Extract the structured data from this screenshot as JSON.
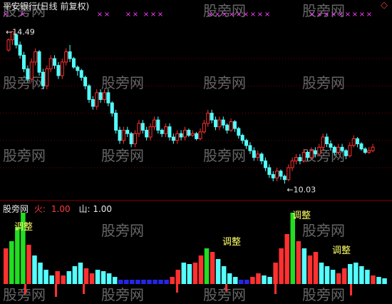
{
  "header": {
    "title": "平安银行(日线 前复权)",
    "diamond": "◇"
  },
  "indicator_header": {
    "name": "股旁网",
    "fire_label": "火:",
    "fire_value": "1.00",
    "mount_label": "山:",
    "mount_value": "1.00"
  },
  "colors": {
    "background": "#000000",
    "up": "#ff3030",
    "down": "#54ffff",
    "grid": "#7a0000",
    "marker": "#ff40ff",
    "green": "#22dd22",
    "blue": "#2a2aff",
    "annotation": "#ffff66",
    "watermark": "#666666"
  },
  "watermark": "股旁网",
  "chart_data": [
    {
      "type": "candlestick",
      "title": "平安银行(日线 前复权)",
      "ylim": [
        9.6,
        15.0
      ],
      "gridlines": [
        13.7,
        12.9,
        12.1,
        11.3,
        10.5
      ],
      "high_label": "14.49",
      "low_label": "10.03",
      "candles": [
        [
          13.95,
          14.25,
          14.3,
          13.9
        ],
        [
          14.25,
          14.49,
          14.49,
          14.1
        ],
        [
          14.4,
          14.1,
          14.45,
          14.0
        ],
        [
          14.1,
          13.8,
          14.2,
          13.7
        ],
        [
          13.8,
          13.4,
          13.9,
          13.3
        ],
        [
          13.4,
          13.1,
          13.5,
          13.0
        ],
        [
          13.1,
          13.6,
          13.7,
          13.0
        ],
        [
          13.6,
          13.9,
          14.0,
          13.5
        ],
        [
          13.9,
          13.3,
          13.95,
          13.2
        ],
        [
          13.3,
          12.9,
          13.4,
          12.8
        ],
        [
          12.9,
          13.4,
          13.5,
          12.8
        ],
        [
          13.4,
          13.7,
          13.8,
          13.3
        ],
        [
          13.7,
          13.5,
          13.8,
          13.4
        ],
        [
          13.5,
          13.2,
          13.6,
          13.1
        ],
        [
          13.2,
          13.6,
          13.7,
          13.1
        ],
        [
          13.6,
          13.9,
          14.0,
          13.5
        ],
        [
          13.9,
          13.7,
          14.1,
          13.6
        ],
        [
          13.7,
          13.45,
          13.75,
          13.4
        ],
        [
          13.45,
          13.35,
          13.5,
          13.2
        ],
        [
          13.35,
          13.15,
          13.4,
          13.05
        ],
        [
          13.15,
          12.9,
          13.2,
          12.8
        ],
        [
          12.9,
          12.5,
          12.95,
          12.4
        ],
        [
          12.5,
          12.3,
          12.6,
          12.2
        ],
        [
          12.3,
          12.7,
          12.8,
          12.2
        ],
        [
          12.7,
          12.5,
          12.8,
          12.4
        ],
        [
          12.5,
          12.7,
          12.8,
          12.4
        ],
        [
          12.7,
          12.4,
          12.8,
          12.3
        ],
        [
          12.4,
          12.1,
          12.45,
          12.0
        ],
        [
          12.1,
          11.6,
          12.2,
          11.5
        ],
        [
          11.6,
          11.3,
          11.7,
          11.2
        ],
        [
          11.3,
          11.6,
          11.7,
          11.2
        ],
        [
          11.6,
          11.5,
          11.7,
          11.4
        ],
        [
          11.5,
          11.2,
          11.55,
          11.1
        ],
        [
          11.2,
          11.5,
          11.6,
          11.1
        ],
        [
          11.5,
          11.8,
          11.9,
          11.4
        ],
        [
          11.8,
          11.6,
          11.9,
          11.5
        ],
        [
          11.6,
          11.4,
          11.7,
          11.3
        ],
        [
          11.4,
          11.7,
          11.8,
          11.3
        ],
        [
          11.7,
          11.9,
          12.0,
          11.6
        ],
        [
          11.9,
          11.6,
          12.0,
          11.5
        ],
        [
          11.6,
          11.5,
          11.65,
          11.4
        ],
        [
          11.5,
          11.7,
          11.8,
          11.4
        ],
        [
          11.7,
          11.4,
          11.8,
          11.3
        ],
        [
          11.4,
          11.3,
          11.5,
          11.2
        ],
        [
          11.3,
          11.5,
          11.6,
          11.2
        ],
        [
          11.5,
          11.4,
          11.6,
          11.3
        ],
        [
          11.4,
          11.6,
          11.7,
          11.3
        ],
        [
          11.6,
          11.45,
          11.65,
          11.4
        ],
        [
          11.45,
          11.5,
          11.6,
          11.4
        ],
        [
          11.5,
          11.35,
          11.55,
          11.3
        ],
        [
          11.35,
          11.55,
          11.65,
          11.3
        ],
        [
          11.55,
          11.8,
          11.9,
          11.5
        ],
        [
          11.8,
          12.1,
          12.2,
          11.7
        ],
        [
          12.1,
          11.9,
          12.2,
          11.8
        ],
        [
          11.9,
          11.7,
          12.0,
          11.6
        ],
        [
          11.7,
          11.9,
          12.0,
          11.6
        ],
        [
          11.9,
          11.75,
          12.0,
          11.65
        ],
        [
          11.75,
          11.6,
          11.8,
          11.5
        ],
        [
          11.6,
          11.85,
          11.95,
          11.55
        ],
        [
          11.85,
          11.65,
          11.9,
          11.55
        ],
        [
          11.65,
          11.45,
          11.7,
          11.35
        ],
        [
          11.45,
          11.3,
          11.5,
          11.2
        ],
        [
          11.3,
          11.15,
          11.35,
          11.05
        ],
        [
          11.15,
          11.0,
          11.25,
          10.9
        ],
        [
          11.0,
          10.8,
          11.1,
          10.7
        ],
        [
          10.8,
          10.9,
          11.0,
          10.7
        ],
        [
          10.9,
          10.7,
          10.95,
          10.6
        ],
        [
          10.7,
          10.5,
          10.8,
          10.4
        ],
        [
          10.5,
          10.3,
          10.6,
          10.2
        ],
        [
          10.3,
          10.2,
          10.4,
          10.1
        ],
        [
          10.2,
          10.4,
          10.5,
          10.1
        ],
        [
          10.4,
          10.25,
          10.45,
          10.15
        ],
        [
          10.25,
          10.15,
          10.3,
          10.03
        ],
        [
          10.15,
          10.5,
          10.6,
          10.1
        ],
        [
          10.5,
          10.7,
          10.8,
          10.4
        ],
        [
          10.7,
          10.8,
          10.9,
          10.6
        ],
        [
          10.8,
          10.7,
          10.9,
          10.6
        ],
        [
          10.7,
          10.95,
          11.05,
          10.65
        ],
        [
          10.95,
          10.8,
          11.0,
          10.7
        ],
        [
          10.8,
          11.0,
          11.1,
          10.75
        ],
        [
          11.0,
          10.9,
          11.1,
          10.8
        ],
        [
          10.9,
          11.1,
          11.2,
          10.85
        ],
        [
          11.1,
          11.4,
          11.5,
          11.0
        ],
        [
          11.4,
          11.2,
          11.5,
          11.1
        ],
        [
          11.2,
          11.1,
          11.3,
          11.0
        ],
        [
          11.1,
          10.95,
          11.15,
          10.85
        ],
        [
          10.95,
          11.1,
          11.2,
          10.9
        ],
        [
          11.1,
          11.0,
          11.2,
          10.95
        ],
        [
          11.0,
          10.85,
          11.05,
          10.75
        ],
        [
          10.85,
          11.15,
          11.25,
          10.8
        ],
        [
          11.15,
          11.35,
          11.45,
          11.1
        ],
        [
          11.35,
          11.2,
          11.4,
          11.1
        ],
        [
          11.2,
          11.05,
          11.25,
          11.0
        ],
        [
          11.05,
          10.95,
          11.1,
          10.9
        ],
        [
          10.95,
          11.0,
          11.1,
          10.9
        ],
        [
          11.0,
          11.1,
          11.2,
          10.95
        ]
      ]
    },
    {
      "type": "bar",
      "title": "股旁网",
      "annotations": [
        "调整",
        "调整",
        "调整",
        "调整"
      ],
      "values": [
        {
          "t": "r",
          "h": 0.5
        },
        {
          "t": "g",
          "h": 0.6
        },
        {
          "t": "g",
          "h": 0.8
        },
        {
          "t": "g",
          "h": 1.0
        },
        {
          "t": "r",
          "h": 0.55
        },
        {
          "t": "c",
          "h": 0.4
        },
        {
          "t": "c",
          "h": 0.3
        },
        {
          "t": "c",
          "h": 0.2
        },
        {
          "t": "c",
          "h": 0.12
        },
        {
          "t": "r",
          "h": 0.18
        },
        {
          "t": "r",
          "h": 0.12
        },
        {
          "t": "c",
          "h": 0.18
        },
        {
          "t": "c",
          "h": 0.25
        },
        {
          "t": "c",
          "h": 0.3
        },
        {
          "t": "r",
          "h": 0.22
        },
        {
          "t": "r",
          "h": 0.15
        },
        {
          "t": "c",
          "h": 0.2
        },
        {
          "t": "c",
          "h": 0.18
        },
        {
          "t": "c",
          "h": 0.15
        },
        {
          "t": "c",
          "h": 0.1
        },
        {
          "t": "b",
          "h": 0.06
        },
        {
          "t": "b",
          "h": 0.06
        },
        {
          "t": "b",
          "h": 0.06
        },
        {
          "t": "b",
          "h": 0.06
        },
        {
          "t": "b",
          "h": 0.06
        },
        {
          "t": "b",
          "h": 0.06
        },
        {
          "t": "b",
          "h": 0.06
        },
        {
          "t": "b",
          "h": 0.06
        },
        {
          "t": "b",
          "h": 0.06
        },
        {
          "t": "r",
          "h": 0.1
        },
        {
          "t": "r",
          "h": 0.2
        },
        {
          "t": "c",
          "h": 0.3
        },
        {
          "t": "c",
          "h": 0.28
        },
        {
          "t": "r",
          "h": 0.3
        },
        {
          "t": "r",
          "h": 0.4
        },
        {
          "t": "g",
          "h": 0.5
        },
        {
          "t": "r",
          "h": 0.45
        },
        {
          "t": "c",
          "h": 0.35
        },
        {
          "t": "c",
          "h": 0.25
        },
        {
          "t": "c",
          "h": 0.15
        },
        {
          "t": "c",
          "h": 0.1
        },
        {
          "t": "b",
          "h": 0.06
        },
        {
          "t": "b",
          "h": 0.06
        },
        {
          "t": "r",
          "h": 0.1
        },
        {
          "t": "r",
          "h": 0.15
        },
        {
          "t": "c",
          "h": 0.12
        },
        {
          "t": "c",
          "h": 0.1
        },
        {
          "t": "r",
          "h": 0.3
        },
        {
          "t": "r",
          "h": 0.5
        },
        {
          "t": "r",
          "h": 0.7
        },
        {
          "t": "g",
          "h": 1.0
        },
        {
          "t": "r",
          "h": 0.6
        },
        {
          "t": "c",
          "h": 0.5
        },
        {
          "t": "r",
          "h": 0.4
        },
        {
          "t": "r",
          "h": 0.45
        },
        {
          "t": "c",
          "h": 0.3
        },
        {
          "t": "c",
          "h": 0.25
        },
        {
          "t": "c",
          "h": 0.2
        },
        {
          "t": "r",
          "h": 0.15
        },
        {
          "t": "r",
          "h": 0.22
        },
        {
          "t": "c",
          "h": 0.28
        },
        {
          "t": "c",
          "h": 0.3
        },
        {
          "t": "c",
          "h": 0.25
        },
        {
          "t": "c",
          "h": 0.2
        },
        {
          "t": "r",
          "h": 0.12
        },
        {
          "t": "c",
          "h": 0.1
        },
        {
          "t": "c",
          "h": 0.08
        }
      ]
    }
  ]
}
